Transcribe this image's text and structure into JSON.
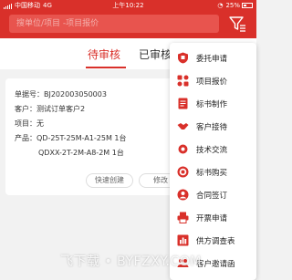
{
  "status_bar": {
    "carrier": "中国移动",
    "network": "4G",
    "time": "上午10:22",
    "battery": "25%"
  },
  "search": {
    "placeholder": "搜单位/项目 -项目报价"
  },
  "tabs": [
    {
      "label": "待审核",
      "active": true
    },
    {
      "label": "已审核",
      "active": false
    }
  ],
  "card": {
    "doc_no": "单据号：BJ202003050003",
    "customer": "客户：测试订单客户2",
    "project": "项目：无",
    "product_1": "产品：QD-25T-25M-A1-25M 1台",
    "product_2": "QDXX-2T-2M-A8-2M 1台",
    "btn_quick": "快速创建",
    "btn_edit": "修改"
  },
  "menu": [
    {
      "label": "委托申请",
      "icon": "shield-icon"
    },
    {
      "label": "项目报价",
      "icon": "grid-icon"
    },
    {
      "label": "标书制作",
      "icon": "document-icon"
    },
    {
      "label": "客户接待",
      "icon": "handshake-icon"
    },
    {
      "label": "技术交流",
      "icon": "gear-icon"
    },
    {
      "label": "标书购买",
      "icon": "target-icon"
    },
    {
      "label": "合同签订",
      "icon": "person-icon"
    },
    {
      "label": "开票申请",
      "icon": "printer-icon"
    },
    {
      "label": "供方调查表",
      "icon": "chart-icon"
    },
    {
      "label": "客户邀请函",
      "icon": "group-icon"
    }
  ],
  "watermark": "飞下载 • BYFZXY.COM",
  "colors": {
    "accent": "#d9302a"
  }
}
